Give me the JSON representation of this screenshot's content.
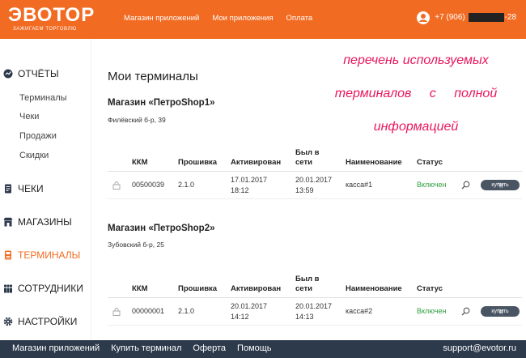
{
  "header": {
    "logo_main": "ЭВОТОР",
    "logo_sub": "ЗАЖИГАЕМ ТОРГОВЛЮ",
    "nav": [
      "Магазин приложений",
      "Мои приложения",
      "Оплата"
    ],
    "phone_prefix": "+7 (906)",
    "phone_suffix": "-28"
  },
  "sidebar": {
    "reports": {
      "label": "ОТЧЁТЫ",
      "items": [
        "Терминалы",
        "Чеки",
        "Продажи",
        "Скидки"
      ]
    },
    "sections": [
      "ЧЕКИ",
      "МАГАЗИНЫ",
      "ТЕРМИНАЛЫ",
      "СОТРУДНИКИ",
      "НАСТРОЙКИ"
    ]
  },
  "main": {
    "page_title": "Мои терминалы",
    "columns": [
      "ККМ",
      "Прошивка",
      "Активирован",
      "Был в сети",
      "Наименование",
      "Статус"
    ],
    "buy_label": "купить",
    "shops": [
      {
        "title": "Магазин «ПетроShop1»",
        "address": "Филёвский б-р, 39",
        "rows": [
          {
            "kkm": "00500039",
            "firmware": "2.1.0",
            "activated_date": "17.01.2017",
            "activated_time": "18:12",
            "online_date": "20.01.2017",
            "online_time": "13:59",
            "name": "касса#1",
            "status": "Включен"
          }
        ]
      },
      {
        "title": "Магазин «ПетроShop2»",
        "address": "Зубовский б-р, 25",
        "rows": [
          {
            "kkm": "00000001",
            "firmware": "2.1.0",
            "activated_date": "20.01.2017",
            "activated_time": "14:12",
            "online_date": "20.01.2017",
            "online_time": "14:13",
            "name": "касса#2",
            "status": "Включен"
          }
        ]
      }
    ]
  },
  "annotation": {
    "line1": "перечень используемых",
    "line2": "терминалов с полной",
    "line3": "информацией"
  },
  "footer": {
    "links": [
      "Магазин приложений",
      "Купить терминал",
      "Оферта",
      "Помощь"
    ],
    "email": "support@evotor.ru"
  },
  "colors": {
    "brand_orange": "#f26b22",
    "footer_dark": "#2d3a4b",
    "status_green": "#2e9e3e",
    "annotation_pink": "#e8175d"
  }
}
